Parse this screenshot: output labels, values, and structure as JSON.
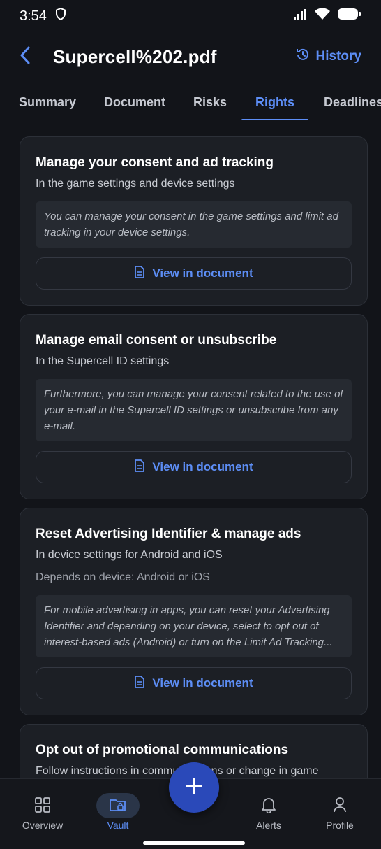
{
  "status": {
    "time": "3:54"
  },
  "header": {
    "title": "Supercell%202.pdf",
    "history_label": "History"
  },
  "tabs": [
    {
      "label": "Summary"
    },
    {
      "label": "Document"
    },
    {
      "label": "Risks"
    },
    {
      "label": "Rights"
    },
    {
      "label": "Deadlines"
    }
  ],
  "cards": [
    {
      "title": "Manage your consent and ad tracking",
      "subtitle": "In the game settings and device settings",
      "quote": "You can manage your consent in the game settings and limit ad tracking in your device settings.",
      "button": "View in document"
    },
    {
      "title": "Manage email consent or unsubscribe",
      "subtitle": "In the Supercell ID settings",
      "quote": "Furthermore, you can manage your consent related to  the use of your e-mail in the Supercell ID settings or unsubscribe from any e-mail.",
      "button": "View in document"
    },
    {
      "title": "Reset Advertising Identifier & manage ads",
      "subtitle": "In device settings for Android and iOS",
      "note": "Depends on device: Android or iOS",
      "quote": "For mobile advertising in apps, you can reset your Advertising Identifier and depending on your  device, select to opt out of interest-based ads (Android) or turn on the Limit Ad Tracking...",
      "button": "View in document"
    },
    {
      "title": "Opt out of promotional communications",
      "subtitle": "Follow instructions in communications or change in game"
    }
  ],
  "nav": [
    {
      "label": "Overview",
      "icon": "grid-icon"
    },
    {
      "label": "Vault",
      "icon": "folder-lock-icon"
    },
    {
      "label": "Alerts",
      "icon": "bell-icon"
    },
    {
      "label": "Profile",
      "icon": "person-icon"
    }
  ],
  "colors": {
    "accent": "#5d8ef6",
    "background": "#121419",
    "card": "#1c1f25",
    "fab": "#2a49b9"
  }
}
